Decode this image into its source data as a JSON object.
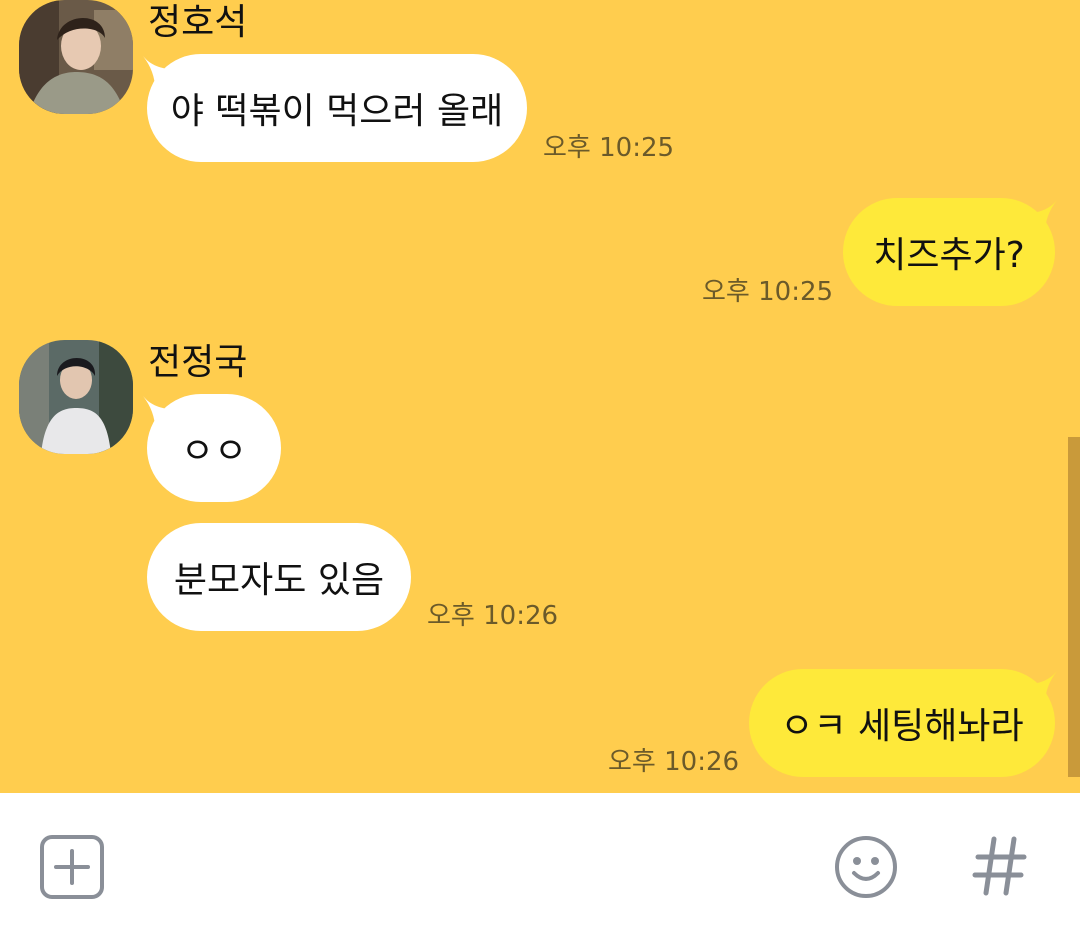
{
  "messages": [
    {
      "direction": "incoming",
      "sender": "정호석",
      "avatar_icon": "person-photo-icon",
      "text": "야 떡볶이 먹으러 올래",
      "time": "오후 10:25"
    },
    {
      "direction": "outgoing",
      "text": "치즈추가?",
      "time": "오후 10:25"
    },
    {
      "direction": "incoming",
      "sender": "전정국",
      "avatar_icon": "person-photo-icon",
      "text": "ㅇㅇ",
      "time": ""
    },
    {
      "direction": "incoming",
      "text": "분모자도 있음",
      "time": "오후 10:26"
    },
    {
      "direction": "outgoing",
      "text": "ㅇㅋ 세팅해놔라",
      "time": "오후 10:26"
    }
  ],
  "input_bar": {
    "plus_icon": "plus-square-icon",
    "emoji_icon": "smiley-icon",
    "hash_icon": "hash-icon"
  },
  "colors": {
    "background": "#FFCD4E",
    "incoming_bubble": "#FFFFFF",
    "outgoing_bubble": "#FEE93A",
    "timestamp": "#6B5A2A",
    "icon": "#8A8F98"
  }
}
